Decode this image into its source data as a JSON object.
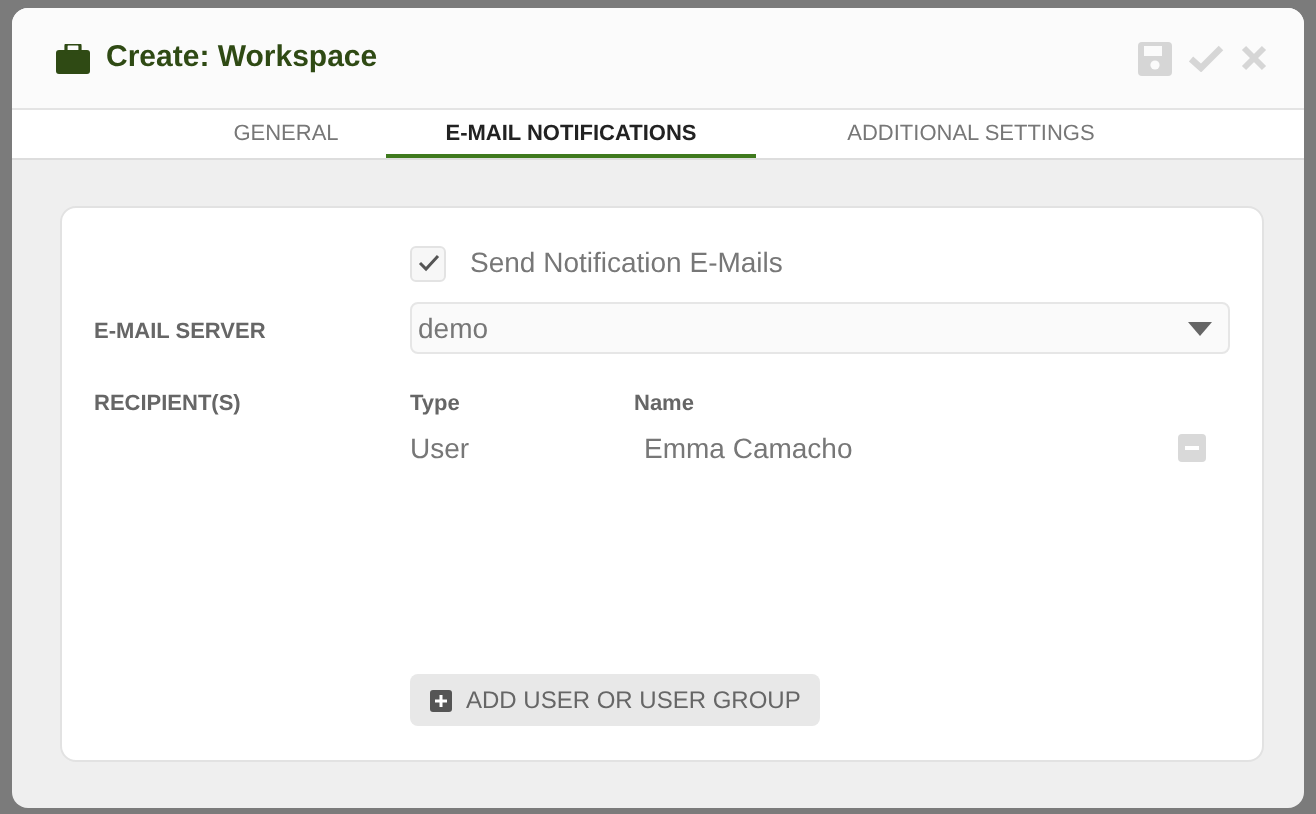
{
  "window": {
    "title": "Create: Workspace"
  },
  "tabs": [
    {
      "label": "GENERAL",
      "selected": false
    },
    {
      "label": "E-MAIL NOTIFICATIONS",
      "selected": true
    },
    {
      "label": "ADDITIONAL SETTINGS",
      "selected": false
    }
  ],
  "send_notifications": {
    "label": "Send Notification E-Mails",
    "checked": true
  },
  "email_server": {
    "label": "E-MAIL SERVER",
    "value": "demo"
  },
  "recipients": {
    "label": "RECIPIENT(S)",
    "columns": [
      "Type",
      "Name"
    ],
    "rows": [
      {
        "type": "User",
        "name": "Emma Camacho"
      }
    ]
  },
  "add_button": "ADD USER OR USER GROUP"
}
